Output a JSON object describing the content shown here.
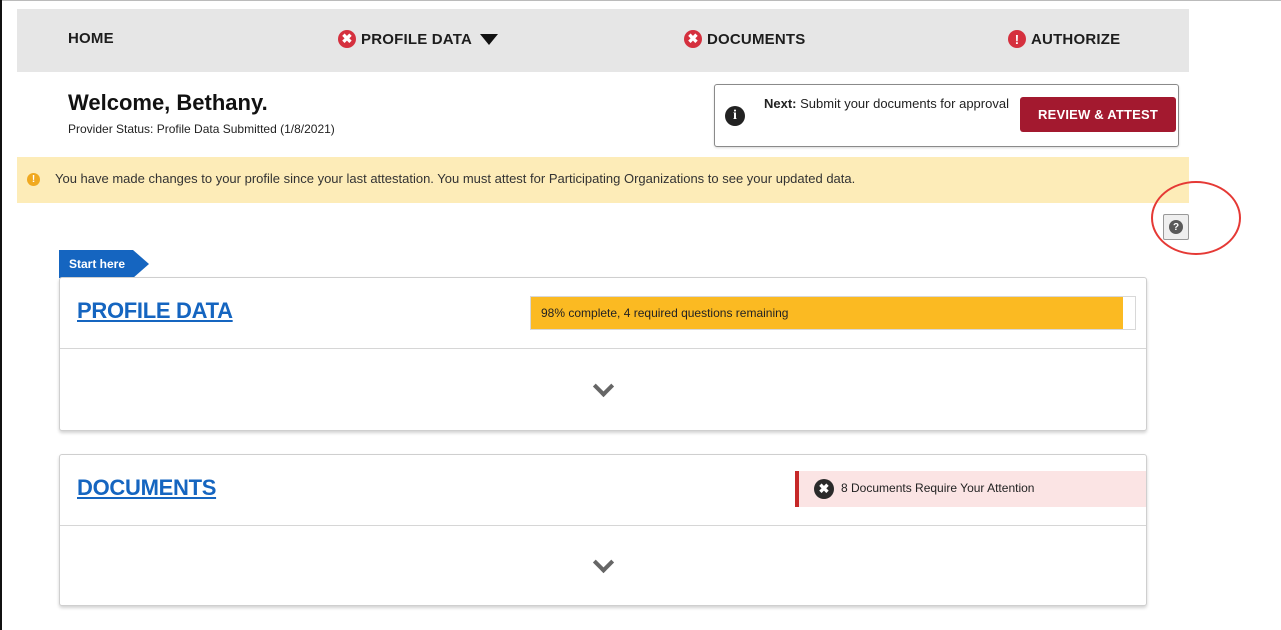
{
  "nav": {
    "home": "HOME",
    "profile_data": "PROFILE DATA",
    "documents": "DOCUMENTS",
    "authorize": "AUTHORIZE",
    "icon_error": "✖",
    "icon_warning": "!"
  },
  "header": {
    "welcome": "Welcome, Bethany.",
    "provider_status": "Provider Status:  Profile Data Submitted (1/8/2021)"
  },
  "next_step": {
    "label": "Next:",
    "text": " Submit your documents for approval",
    "button": "REVIEW & ATTEST",
    "icon": "i"
  },
  "alert": {
    "icon": "!",
    "message": "You have made changes to your profile since your last attestation. You must attest for Participating Organizations to see your updated data."
  },
  "help": {
    "icon": "?"
  },
  "start_tab": "Start here",
  "profile_card": {
    "title": "PROFILE DATA",
    "progress_text": "98% complete, 4 required questions remaining",
    "progress_value": 0.98
  },
  "documents_card": {
    "title": "DOCUMENTS",
    "status_text": "8 Documents Require Your Attention",
    "icon": "✖"
  },
  "colors": {
    "nav_bg": "#e6e6e6",
    "error": "#d5303e",
    "button": "#a3192f",
    "link": "#1565c0",
    "progress": "#fbba22",
    "alert_bg": "#fdecb8"
  }
}
